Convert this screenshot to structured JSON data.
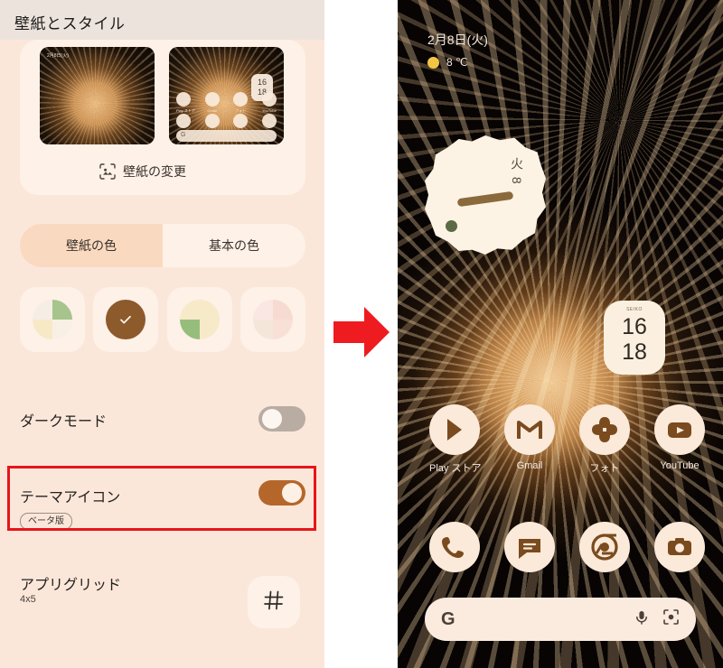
{
  "left_panel": {
    "header_title": "壁紙とスタイル",
    "wallpaper_change": {
      "label": "壁紙の変更",
      "icon": "wallpaper-change-icon"
    },
    "preview_thumbs": [
      {
        "name": "lock-screen-preview",
        "date": "2月8日(火)"
      },
      {
        "name": "home-screen-preview",
        "apps_row1": [
          "Play ストア",
          "Gmail",
          "フォト",
          "YouTube"
        ],
        "apps_row2": [
          "電話",
          "メッセージ",
          "Chrome",
          "カメラ"
        ],
        "search_glyph": "G",
        "clock": "16\n18"
      }
    ],
    "color_tabs": [
      {
        "label": "壁紙の色",
        "active": true
      },
      {
        "label": "基本の色",
        "active": false
      }
    ],
    "swatches": [
      {
        "name": "swatch-1",
        "selected": false,
        "colors": [
          "#f3ece2",
          "#9dbf86",
          "#f6e7c2",
          "#f7efe3"
        ]
      },
      {
        "name": "swatch-2",
        "selected": true,
        "colors": [
          "#8c5a2b",
          "#8c5a2b",
          "#8c5a2b",
          "#8c5a2b"
        ],
        "check": "✓"
      },
      {
        "name": "swatch-3",
        "selected": false,
        "colors": [
          "#f6e9c7",
          "#f6e9c7",
          "#8fb877",
          "#f6e9c7"
        ]
      },
      {
        "name": "swatch-4",
        "selected": false,
        "colors": [
          "#f9e3e0",
          "#f6d9cf",
          "#f4e4d8",
          "#f7ded4"
        ]
      }
    ],
    "rows": [
      {
        "name": "dark-mode",
        "label": "ダークモード",
        "toggle": "off"
      },
      {
        "name": "theme-icons",
        "label": "テーマアイコン",
        "badge": "ベータ版",
        "toggle": "on",
        "highlighted": true
      },
      {
        "name": "app-grid",
        "label": "アプリグリッド",
        "value": "4x5",
        "button_icon": "grid-icon"
      }
    ]
  },
  "arrow": {
    "name": "red-right-arrow",
    "color": "#ee1c20"
  },
  "right_phone": {
    "status": {
      "date": "2月8日(火)",
      "temperature": "8 ℃",
      "weather_icon": "sun-icon"
    },
    "calendar_widget": {
      "day_text": "火 8"
    },
    "clock_widget": {
      "brand": "SEIKO",
      "hours": "16",
      "minutes": "18"
    },
    "apps_row1": [
      {
        "name": "play-store",
        "label": "Play ストア"
      },
      {
        "name": "gmail",
        "label": "Gmail"
      },
      {
        "name": "photos",
        "label": "フォト"
      },
      {
        "name": "youtube",
        "label": "YouTube"
      }
    ],
    "apps_row2": [
      {
        "name": "phone",
        "label": ""
      },
      {
        "name": "messages",
        "label": ""
      },
      {
        "name": "chrome",
        "label": ""
      },
      {
        "name": "camera",
        "label": ""
      }
    ],
    "search_bar": {
      "glyph": "G",
      "mic_icon": "mic-icon",
      "lens_icon": "lens-icon"
    }
  }
}
